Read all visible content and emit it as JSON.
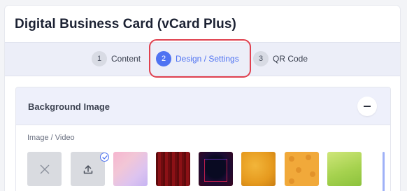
{
  "page": {
    "title": "Digital Business Card (vCard Plus)"
  },
  "steps": [
    {
      "number": "1",
      "label": "Content",
      "active": false
    },
    {
      "number": "2",
      "label": "Design / Settings",
      "active": true
    },
    {
      "number": "3",
      "label": "QR Code",
      "active": false
    }
  ],
  "section": {
    "title": "Background Image",
    "field_label": "Image / Video",
    "selected_index": 2,
    "thumbnails": [
      {
        "icon": "close-icon"
      },
      {
        "icon": "upload-icon"
      },
      {
        "icon": "pink-gradient"
      },
      {
        "icon": "red-curtain"
      },
      {
        "icon": "dark-stage"
      },
      {
        "icon": "gold-texture"
      },
      {
        "icon": "paw-pattern"
      },
      {
        "icon": "green-watercolor"
      }
    ]
  },
  "colors": {
    "accent": "#4f73f2",
    "highlight": "#e0414f",
    "stepbar_bg": "#eceef8"
  }
}
